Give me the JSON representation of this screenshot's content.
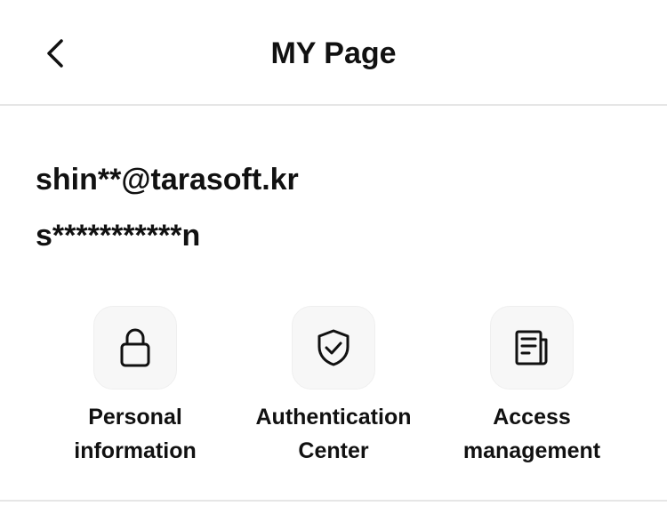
{
  "header": {
    "title": "MY Page",
    "back_icon": "chevron-left-icon"
  },
  "profile": {
    "email": "shin**@tarasoft.kr",
    "name": "s***********n"
  },
  "menu": {
    "items": [
      {
        "label": "Personal\ninformation",
        "icon": "lock-icon"
      },
      {
        "label": "Authentication\nCenter",
        "icon": "shield-check-icon"
      },
      {
        "label": "Access\nmanagement",
        "icon": "document-icon"
      }
    ]
  },
  "colors": {
    "text": "#111111",
    "icon_bg": "#f7f7f7",
    "divider": "#e6e6e6"
  }
}
